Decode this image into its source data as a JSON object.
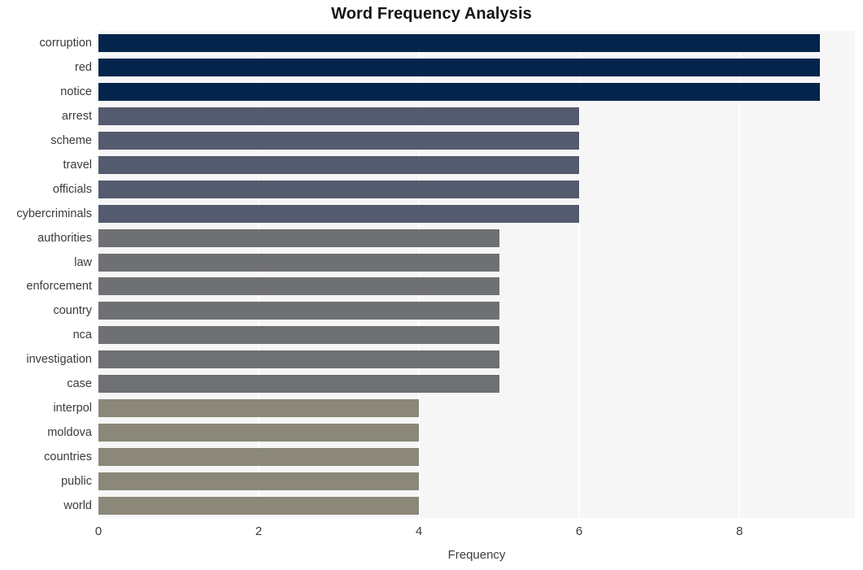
{
  "chart_data": {
    "type": "bar",
    "orientation": "horizontal",
    "title": "Word Frequency Analysis",
    "xlabel": "Frequency",
    "ylabel": "",
    "categories": [
      "corruption",
      "red",
      "notice",
      "arrest",
      "scheme",
      "travel",
      "officials",
      "cybercriminals",
      "authorities",
      "law",
      "enforcement",
      "country",
      "nca",
      "investigation",
      "case",
      "interpol",
      "moldova",
      "countries",
      "public",
      "world"
    ],
    "values": [
      9,
      9,
      9,
      6,
      6,
      6,
      6,
      6,
      5,
      5,
      5,
      5,
      5,
      5,
      5,
      4,
      4,
      4,
      4,
      4
    ],
    "bar_colors": [
      "#04244c",
      "#04244c",
      "#04244c",
      "#555b6e",
      "#555b6e",
      "#555b6e",
      "#555b6e",
      "#555b6e",
      "#6e7073",
      "#6e7073",
      "#6e7073",
      "#6e7073",
      "#6e7073",
      "#6e7073",
      "#6e7073",
      "#8b8879",
      "#8b8879",
      "#8b8879",
      "#8b8879",
      "#8b8879"
    ],
    "xlim": [
      0,
      9.44
    ],
    "xticks": [
      0,
      2,
      4,
      6,
      8
    ],
    "xtick_labels": [
      "0",
      "2",
      "4",
      "6",
      "8"
    ],
    "grid": true,
    "grid_axis": "x",
    "grid_color": "#ffffff",
    "plot_background": "#f6f6f7",
    "figure_background": "#ffffff",
    "legend": null,
    "legend_position": "none",
    "annotations": []
  }
}
